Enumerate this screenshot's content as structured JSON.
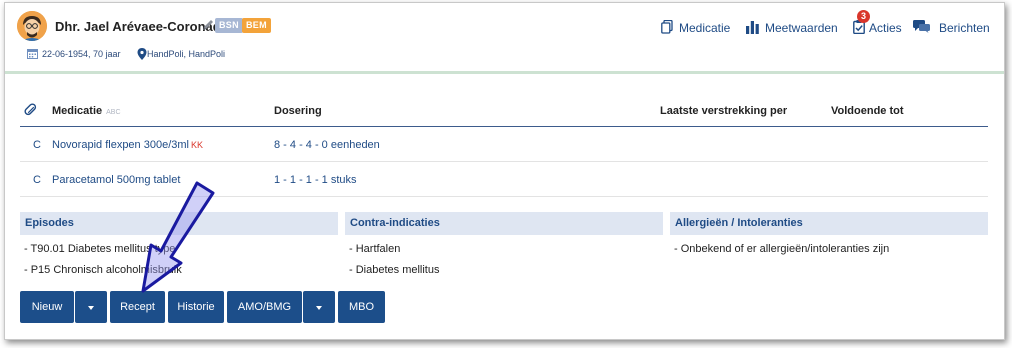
{
  "patient": {
    "name": "Dhr. Jael Arévaee-Coronado",
    "badges": [
      "BSN",
      "BEM"
    ],
    "dob_age": "22-06-1954, 70 jaar",
    "location": "HandPoli, HandPoli"
  },
  "topnav": {
    "medicatie": "Medicatie",
    "meetwaarden": "Meetwaarden",
    "acties": "Acties",
    "acties_count": "3",
    "berichten": "Berichten"
  },
  "medication": {
    "headers": {
      "medicatie": "Medicatie",
      "abc": "ABC",
      "dosering": "Dosering",
      "laatste": "Laatste verstrekking per",
      "voldoende": "Voldoende tot"
    },
    "rows": [
      {
        "code": "C",
        "name": "Novorapid flexpen 300e/3ml",
        "flag": "KK",
        "dose": "8 - 4 - 4 - 0 eenheden"
      },
      {
        "code": "C",
        "name": "Paracetamol 500mg tablet",
        "flag": "",
        "dose": "1 - 1 - 1 - 1 stuks"
      }
    ]
  },
  "panels": {
    "episodes": {
      "title": "Episodes",
      "items": [
        "- T90.01 Diabetes mellitus type",
        "- P15 Chronisch alcoholmisbruik"
      ]
    },
    "contra": {
      "title": "Contra-indicaties",
      "items": [
        "- Hartfalen",
        "- Diabetes mellitus"
      ]
    },
    "allergies": {
      "title": "Allergieën / Intoleranties",
      "items": [
        "- Onbekend of er allergieën/intoleranties zijn"
      ]
    }
  },
  "buttons": {
    "nieuw": "Nieuw",
    "recept": "Recept",
    "historie": "Historie",
    "amo": "AMO/BMG",
    "mbo": "MBO"
  },
  "colors": {
    "brand": "#1c4e8a",
    "link": "#1f4b85",
    "panel_header_bg": "#dfe6f2",
    "badge_bsn": "#a7b7d4",
    "badge_bem": "#f3a33a",
    "alert": "#d9362b"
  }
}
